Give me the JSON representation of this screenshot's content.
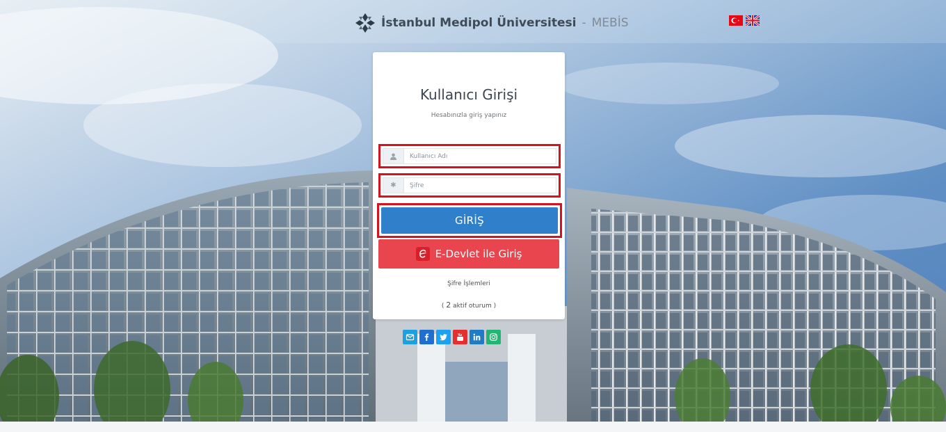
{
  "header": {
    "university_name": "İstanbul Medipol Üniversitesi",
    "separator": " - ",
    "app_name": "MEBİS"
  },
  "languages": [
    {
      "code": "tr",
      "icon": "turkey-flag-icon"
    },
    {
      "code": "en",
      "icon": "uk-flag-icon"
    }
  ],
  "login": {
    "title": "Kullanıcı Girişi",
    "subtitle": "Hesabınızla giriş yapınız",
    "username_placeholder": "Kullanıcı Adı",
    "username_value": "",
    "password_placeholder": "Şifre",
    "password_value": "",
    "login_button": "GİRİŞ",
    "edevlet_button": "E-Devlet ile Giriş",
    "password_link": "Şifre İşlemleri",
    "sessions_open": "( ",
    "sessions_count": "2",
    "sessions_text": " aktif oturum )"
  },
  "social": [
    {
      "name": "email",
      "icon": "envelope-icon",
      "color": "#1ba1e2"
    },
    {
      "name": "facebook",
      "icon": "facebook-icon",
      "color": "#1f6fd1"
    },
    {
      "name": "twitter",
      "icon": "twitter-icon",
      "color": "#1da1f2"
    },
    {
      "name": "youtube",
      "icon": "youtube-icon",
      "color": "#e62e2e"
    },
    {
      "name": "linkedin",
      "icon": "linkedin-icon",
      "color": "#1f7bc4"
    },
    {
      "name": "instagram",
      "icon": "instagram-icon",
      "color": "#22b573"
    }
  ],
  "colors": {
    "login_button": "#2f7fcb",
    "edevlet_button": "#e8454f",
    "highlight_border": "#d6121f"
  }
}
